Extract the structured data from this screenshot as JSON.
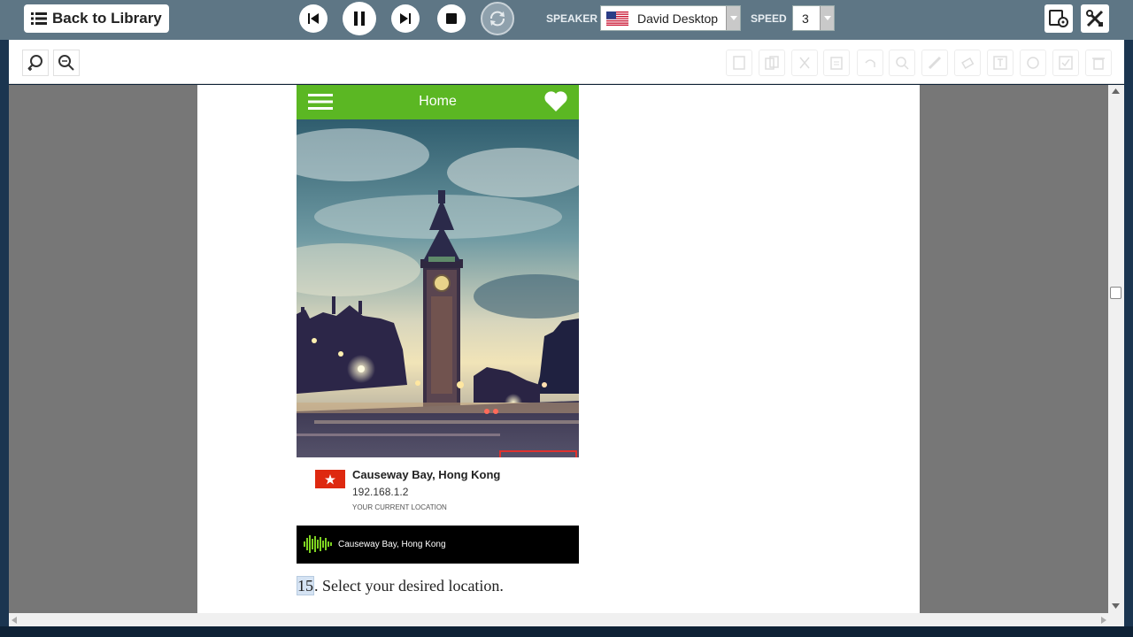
{
  "topbar": {
    "back_label": "Back to Library",
    "speaker_label": "SPEAKER",
    "speaker_value": "David Desktop",
    "speed_label": "SPEED",
    "speed_value": "3"
  },
  "phone": {
    "header_title": "Home",
    "location_name": "Causeway Bay, Hong Kong",
    "ip_address": "192.168.1.2",
    "location_caption": "YOUR CURRENT LOCATION",
    "player_text": "Causeway Bay, Hong Kong"
  },
  "document": {
    "step_number": "15",
    "step_text": ". Select your desired location."
  },
  "colors": {
    "toolbar_bg": "#5e7685",
    "app_green": "#5bb723",
    "highlight_red": "#e0322f"
  },
  "icons": [
    "list-icon",
    "skip-back-icon",
    "pause-icon",
    "skip-forward-icon",
    "stop-icon",
    "repeat-icon",
    "us-flag-icon",
    "device-settings-icon",
    "tools-icon",
    "zoom-in-icon",
    "zoom-out-icon",
    "menu-icon",
    "heart-icon",
    "plug-icon",
    "hk-flag-icon",
    "waveform-icon"
  ]
}
